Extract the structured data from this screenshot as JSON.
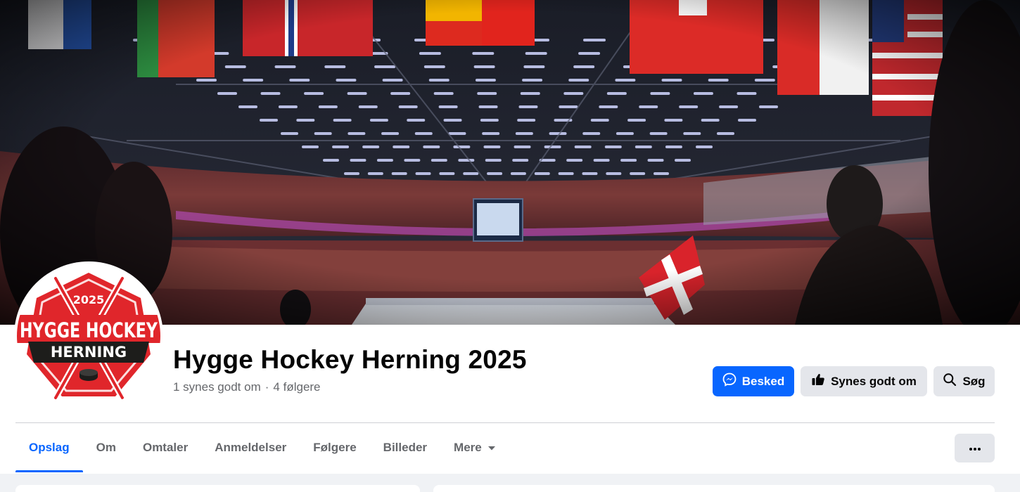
{
  "page": {
    "title": "Hygge Hockey Herning 2025",
    "likes": "1 synes godt om",
    "separator": "·",
    "followers": "4 følgere"
  },
  "logo": {
    "year": "2025",
    "line1": "HYGGE HOCKEY",
    "line2": "HERNING",
    "colors": {
      "red": "#e0262b",
      "black": "#1d1d1b"
    }
  },
  "actions": {
    "message": {
      "label": "Besked",
      "icon": "messenger-icon"
    },
    "like": {
      "label": "Synes godt om",
      "icon": "thumbs-up-icon"
    },
    "search": {
      "label": "Søg",
      "icon": "search-icon"
    },
    "more": {
      "icon": "more-dots-icon"
    }
  },
  "tabs": [
    {
      "label": "Opslag",
      "active": true
    },
    {
      "label": "Om"
    },
    {
      "label": "Omtaler"
    },
    {
      "label": "Anmeldelser"
    },
    {
      "label": "Følgere"
    },
    {
      "label": "Billeder"
    },
    {
      "label": "Mere",
      "icon": "caret-down-icon"
    }
  ],
  "colors": {
    "accent": "#0866ff",
    "text": "#050505",
    "muted": "#65676b",
    "background": "#f0f2f5"
  }
}
